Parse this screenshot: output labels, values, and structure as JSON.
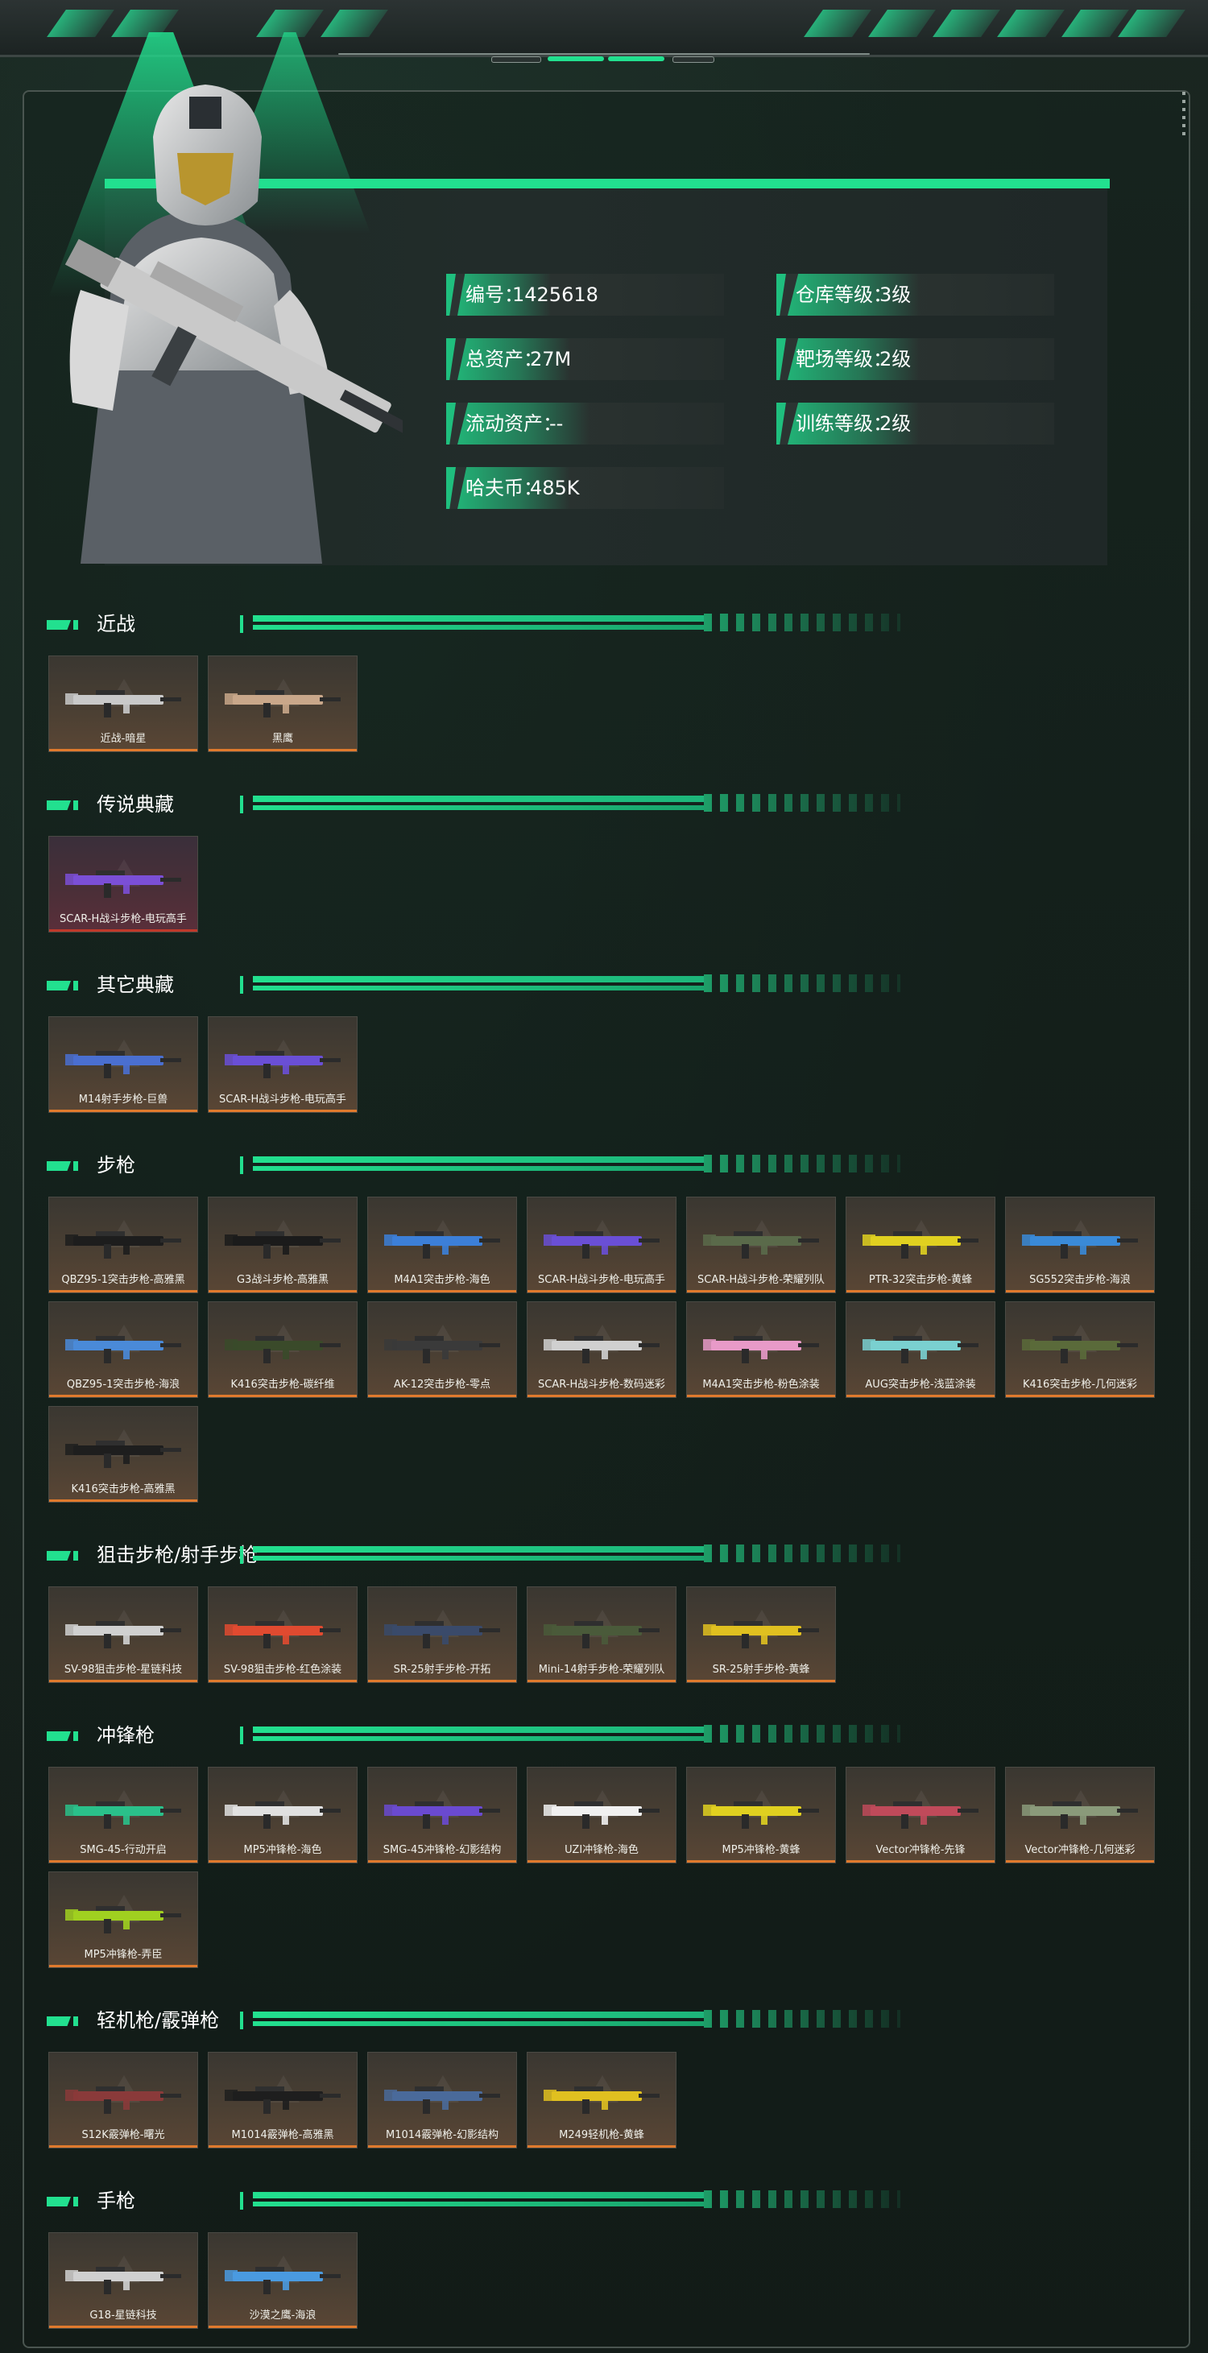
{
  "profile": {
    "stats_left": [
      {
        "label": "编号：",
        "value": "1425618"
      },
      {
        "label": "总资产：",
        "value": "27M"
      },
      {
        "label": "流动资产：",
        "value": "--"
      },
      {
        "label": "哈夫币：",
        "value": "485K"
      }
    ],
    "stats_right": [
      {
        "label": "仓库等级：",
        "value": "3级"
      },
      {
        "label": "靶场等级：",
        "value": "2级"
      },
      {
        "label": "训练等级：",
        "value": "2级"
      }
    ]
  },
  "colors": {
    "accent": "#22e08f",
    "card_rarity_gold": "#e07a2d",
    "card_rarity_red": "#c0392b"
  },
  "sections": [
    {
      "title": "近战",
      "items": [
        {
          "name": "近战-暗星",
          "color": "#c9c9c9"
        },
        {
          "name": "黑鹰",
          "color": "#c9a78a"
        }
      ]
    },
    {
      "title": "传说典藏",
      "items": [
        {
          "name": "SCAR-H战斗步枪-电玩高手",
          "color": "#7b4fd6",
          "rarity": "red"
        }
      ]
    },
    {
      "title": "其它典藏",
      "items": [
        {
          "name": "M14射手步枪-巨兽",
          "color": "#4a6fd0"
        },
        {
          "name": "SCAR-H战斗步枪-电玩高手",
          "color": "#6a4fd6"
        }
      ]
    },
    {
      "title": "步枪",
      "items": [
        {
          "name": "QBZ95-1突击步枪-高雅黑",
          "color": "#1d1d1d"
        },
        {
          "name": "G3战斗步枪-高雅黑",
          "color": "#1b1b1b"
        },
        {
          "name": "M4A1突击步枪-海色",
          "color": "#3c7fd8"
        },
        {
          "name": "SCAR-H战斗步枪-电玩高手",
          "color": "#6a4fd6"
        },
        {
          "name": "SCAR-H战斗步枪-荣耀列队",
          "color": "#5a6a4a"
        },
        {
          "name": "PTR-32突击步枪-黄蜂",
          "color": "#e0d020"
        },
        {
          "name": "SG552突击步枪-海浪",
          "color": "#3a8ad8"
        },
        {
          "name": "QBZ95-1突击步枪-海浪",
          "color": "#4a8ad8"
        },
        {
          "name": "K416突击步枪-碳纤维",
          "color": "#3a4a2a"
        },
        {
          "name": "AK-12突击步枪-零点",
          "color": "#3a3a3a"
        },
        {
          "name": "SCAR-H战斗步枪-数码迷彩",
          "color": "#d0d0d0"
        },
        {
          "name": "M4A1突击步枪-粉色涂装",
          "color": "#e89ac8"
        },
        {
          "name": "AUG突击步枪-浅蓝涂装",
          "color": "#7ad0d0"
        },
        {
          "name": "K416突击步枪-几何迷彩",
          "color": "#5a6a3a"
        },
        {
          "name": "K416突击步枪-高雅黑",
          "color": "#1e1e1e"
        }
      ]
    },
    {
      "title": "狙击步枪/射手步枪",
      "items": [
        {
          "name": "SV-98狙击步枪-星链科技",
          "color": "#d0d0d0"
        },
        {
          "name": "SV-98狙击步枪-红色涂装",
          "color": "#e04a30"
        },
        {
          "name": "SR-25射手步枪-开拓",
          "color": "#3a4a6a"
        },
        {
          "name": "Mini-14射手步枪-荣耀列队",
          "color": "#4a5a3a"
        },
        {
          "name": "SR-25射手步枪-黄蜂",
          "color": "#e0c020"
        }
      ]
    },
    {
      "title": "冲锋枪",
      "items": [
        {
          "name": "SMG-45-行动开启",
          "color": "#2ac08a"
        },
        {
          "name": "MP5冲锋枪-海色",
          "color": "#e0e0e0"
        },
        {
          "name": "SMG-45冲锋枪-幻影结构",
          "color": "#6a4ad0"
        },
        {
          "name": "UZI冲锋枪-海色",
          "color": "#f0f0f0"
        },
        {
          "name": "MP5冲锋枪-黄蜂",
          "color": "#e0d020"
        },
        {
          "name": "Vector冲锋枪-先锋",
          "color": "#c04a5a"
        },
        {
          "name": "Vector冲锋枪-几何迷彩",
          "color": "#8a9a7a"
        },
        {
          "name": "MP5冲锋枪-弄臣",
          "color": "#a0d020"
        }
      ]
    },
    {
      "title": "轻机枪/霰弹枪",
      "items": [
        {
          "name": "S12K霰弹枪-曙光",
          "color": "#8a3a3a"
        },
        {
          "name": "M1014霰弹枪-高雅黑",
          "color": "#1e1e1e"
        },
        {
          "name": "M1014霰弹枪-幻影结构",
          "color": "#4a6a9a"
        },
        {
          "name": "M249轻机枪-黄蜂",
          "color": "#e0c020"
        }
      ]
    },
    {
      "title": "手枪",
      "items": [
        {
          "name": "G18-星链科技",
          "color": "#d0d0d0"
        },
        {
          "name": "沙漠之鹰-海浪",
          "color": "#4a9ae0"
        }
      ]
    }
  ]
}
